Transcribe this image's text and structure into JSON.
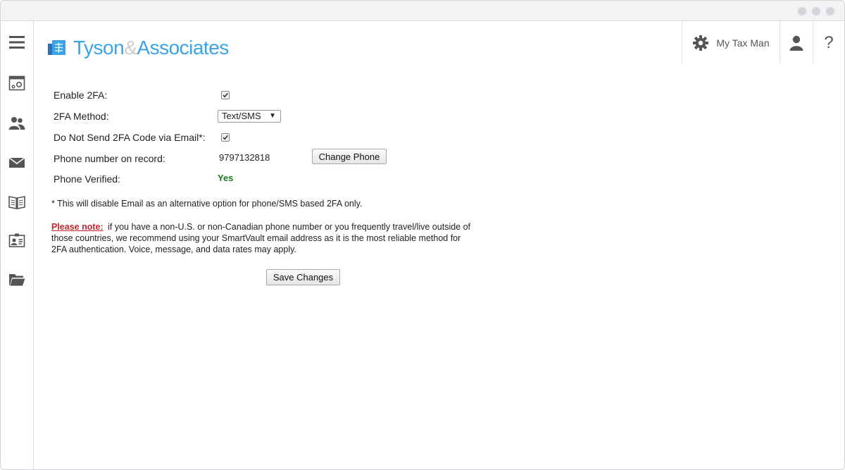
{
  "brand": {
    "name_part1": "Tyson",
    "name_amp": "&",
    "name_part2": "Associates"
  },
  "header": {
    "settings_label": "My Tax Man",
    "help_label": "?"
  },
  "sidebar": {
    "items": [
      {
        "icon": "menu-icon"
      },
      {
        "icon": "dashboard-settings-icon"
      },
      {
        "icon": "contacts-icon"
      },
      {
        "icon": "mail-icon"
      },
      {
        "icon": "book-icon"
      },
      {
        "icon": "id-card-icon"
      },
      {
        "icon": "folder-icon"
      }
    ]
  },
  "form": {
    "enable_2fa_label": "Enable 2FA:",
    "enable_2fa_checked": true,
    "method_label": "2FA Method:",
    "method_value": "Text/SMS",
    "no_email_label": "Do Not Send 2FA Code via Email*:",
    "no_email_checked": true,
    "phone_label": "Phone number on record:",
    "phone_value": "9797132818",
    "change_phone_button": "Change Phone",
    "verified_label": "Phone Verified:",
    "verified_value": "Yes",
    "footnote": "* This will disable Email as an alternative option for phone/SMS based 2FA only.",
    "note_label": "Please note:",
    "note_text": "if you have a non-U.S. or non-Canadian phone number or you frequently travel/live outside of those countries, we recommend using your SmartVault email address as it is the most reliable method for 2FA authentication. Voice, message, and data rates may apply.",
    "save_button": "Save Changes"
  },
  "colors": {
    "brand": "#3aa3e8",
    "note_red": "#c0242c",
    "verified_green": "#1e7a1e"
  }
}
